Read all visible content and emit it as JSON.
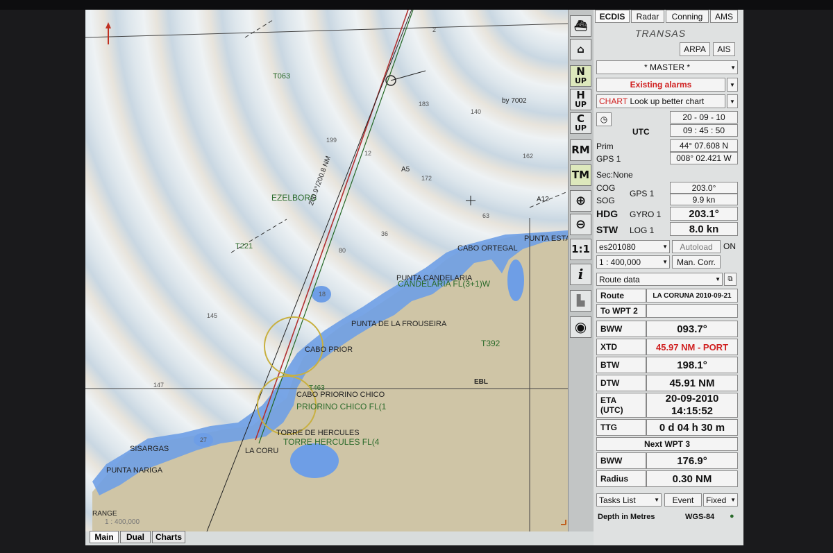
{
  "chart": {
    "labels": {
      "wreck_t063": "T063",
      "wreck_ezelborg": "EZELBORG",
      "wreck_t221": "T221",
      "punta_estaca": "PUNTA ESTA",
      "cabo_ortegal": "CABO ORTEGAL",
      "punta_candelaria": "PUNTA CANDELARIA",
      "candelaria_light": "CANDELARIA FL(3+1)W",
      "punta_frouseira": "PUNTA DE LA FROUSEIRA",
      "cabo_prior": "CABO PRIOR",
      "cabo_priorino": "CABO PRIORINO CHICO",
      "priorino_light": "PRIORINO CHICO FL(1",
      "torre_hercules": "TORRE DE HERCULES",
      "torre_light": "TORRE HERCULES FL(4",
      "la_coruna": "LA CORU",
      "sisargas": "SISARGAS",
      "punta_nariga": "PUNTA NARIGA",
      "t392": "T392",
      "by7002": "by 7002",
      "a5": "A5",
      "a12": "A12",
      "t463": "T463",
      "ebl": "EBL",
      "track_label": "200.9°/200.8 NM",
      "range_label": "RANGE",
      "scale_label": "1 : 400,000",
      "depths": [
        "183",
        "140",
        "199",
        "12",
        "162",
        "172",
        "63",
        "36",
        "80",
        "18",
        "145",
        "147",
        "27",
        "2"
      ]
    }
  },
  "toolbar": {
    "north_up": [
      "N",
      "UP"
    ],
    "head_up": [
      "H",
      "UP"
    ],
    "course_up": [
      "C",
      "UP"
    ],
    "rm": "RM",
    "tm": "TM",
    "one_to_one": "1:1",
    "info": "i"
  },
  "panel": {
    "tabs": [
      "ECDIS",
      "Radar",
      "Conning",
      "AMS"
    ],
    "brand": "TRANSAS",
    "arpa": "ARPA",
    "ais": "AIS",
    "master": "* MASTER *",
    "alarms": "Existing alarms",
    "alarm_tag": "CHART",
    "alarm_text": "Look up better chart",
    "date": "20 - 09 - 10",
    "utc_label": "UTC",
    "time": "09 : 45 : 50",
    "prim_label": "Prim",
    "gps1_label": "GPS 1",
    "lat": "44° 07.608 N",
    "lon": "008° 02.421 W",
    "sec": "Sec:None",
    "cog_label": "COG",
    "sog_label": "SOG",
    "cog_src": "GPS 1",
    "cog": "203.0°",
    "sog": "9.9 kn",
    "hdg_label": "HDG",
    "hdg_src": "GYRO 1",
    "hdg": "203.1°",
    "stw_label": "STW",
    "stw_src": "LOG 1",
    "stw": "8.0 kn",
    "chart_cell": "es201080",
    "autoload": "Autoload",
    "autoload_state": "ON",
    "scale": "1 : 400,000",
    "man_corr": "Man. Corr.",
    "route_data": "Route data",
    "route_label": "Route",
    "route_name": "LA CORUNA 2010-09-21",
    "to_wpt": "To WPT 2",
    "bww_label": "BWW",
    "bww": "093.7°",
    "xtd_label": "XTD",
    "xtd": "45.97 NM - PORT",
    "btw_label": "BTW",
    "btw": "198.1°",
    "dtw_label": "DTW",
    "dtw": "45.91 NM",
    "eta_label": "ETA",
    "eta_utc": "(UTC)",
    "eta_date": "20-09-2010",
    "eta_time": "14:15:52",
    "ttg_label": "TTG",
    "ttg": "0 d 04 h 30 m",
    "next_wpt": "Next WPT 3",
    "bww2_label": "BWW",
    "bww2": "176.9°",
    "radius_label": "Radius",
    "radius": "0.30 NM",
    "tasks": "Tasks List",
    "event": "Event",
    "fixed": "Fixed",
    "depth_units": "Depth in Metres",
    "datum": "WGS-84"
  },
  "bottom_tabs": [
    "Main",
    "Dual",
    "Charts"
  ],
  "colors": {
    "land": "#cfc5a6",
    "shallow_water": "#6e9ee6",
    "route_green": "#2a6a2a",
    "alarm_red": "#d02020"
  }
}
